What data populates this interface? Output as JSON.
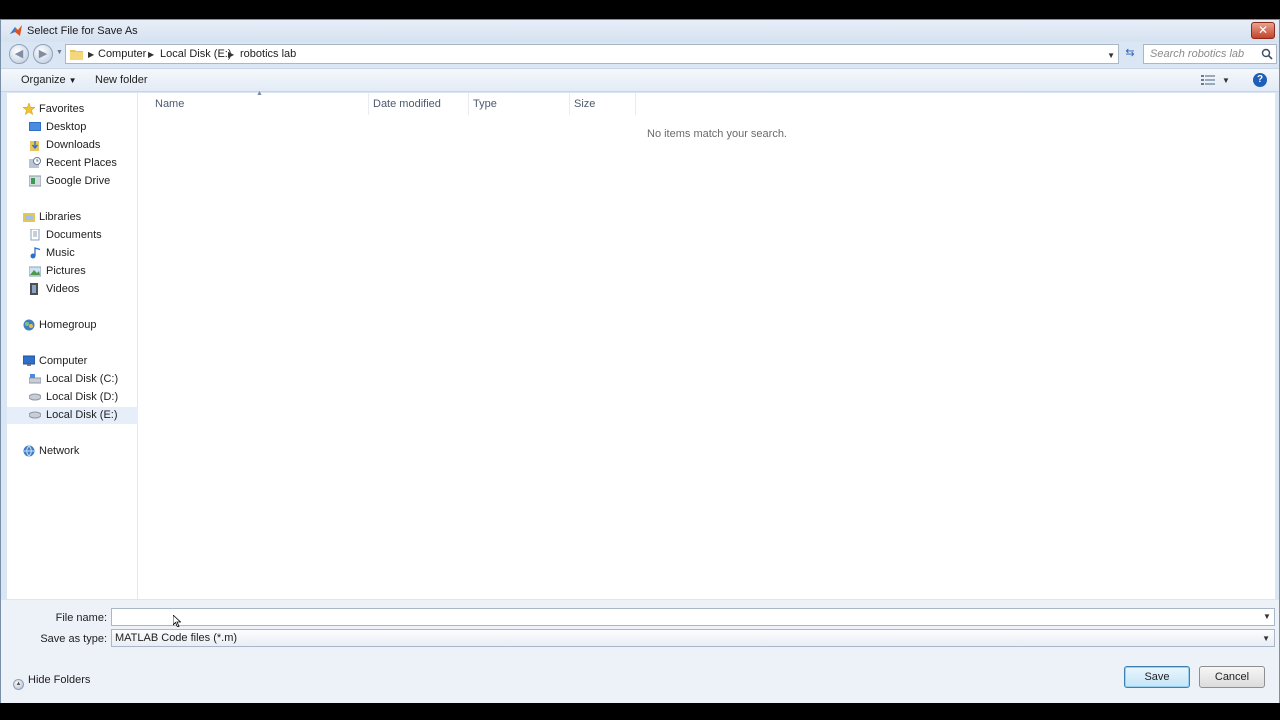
{
  "window": {
    "title": "Select File for Save As",
    "close_label": "✕"
  },
  "address": {
    "crumbs": [
      "Computer",
      "Local Disk (E:)",
      "robotics lab"
    ]
  },
  "search": {
    "placeholder": "Search robotics lab"
  },
  "toolbar": {
    "organize_label": "Organize",
    "new_folder_label": "New folder",
    "help_label": "?"
  },
  "nav_pane": {
    "favorites": {
      "label": "Favorites",
      "items": [
        "Desktop",
        "Downloads",
        "Recent Places",
        "Google Drive"
      ]
    },
    "libraries": {
      "label": "Libraries",
      "items": [
        "Documents",
        "Music",
        "Pictures",
        "Videos"
      ]
    },
    "homegroup": {
      "label": "Homegroup"
    },
    "computer": {
      "label": "Computer",
      "items": [
        "Local Disk (C:)",
        "Local Disk (D:)",
        "Local Disk (E:)"
      ],
      "selected": "Local Disk (E:)"
    },
    "network": {
      "label": "Network"
    }
  },
  "file_list": {
    "columns": [
      "Name",
      "Date modified",
      "Type",
      "Size"
    ],
    "empty_message": "No items match your search."
  },
  "form": {
    "file_name_label": "File name:",
    "file_name_value": "",
    "save_type_label": "Save as type:",
    "save_type_value": "MATLAB Code files (*.m)",
    "hide_folders_label": "Hide Folders",
    "save_label": "Save",
    "cancel_label": "Cancel"
  },
  "colors": {
    "window_chrome": "#dbe6f4",
    "accent_blue": "#1f5fb9",
    "close_red": "#c4432a"
  }
}
